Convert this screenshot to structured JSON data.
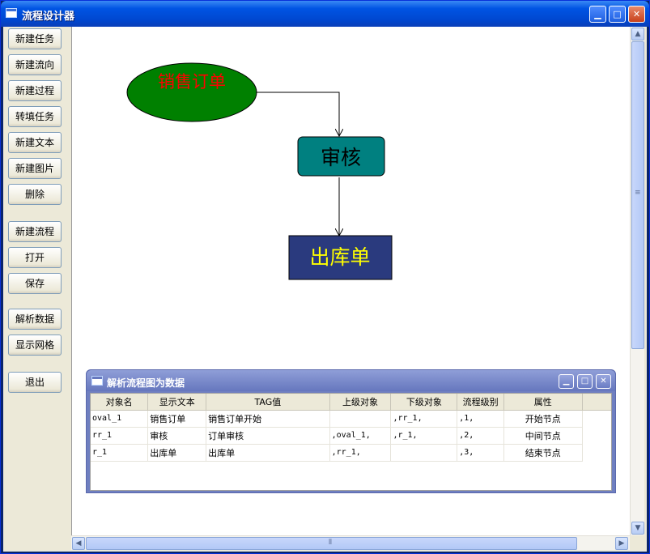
{
  "window": {
    "title": "流程设计器",
    "controls": {
      "minimize": "▁",
      "maximize": "□",
      "close": "✕"
    }
  },
  "toolbox": {
    "buttons": [
      "新建任务",
      "新建流向",
      "新建过程",
      "转填任务",
      "新建文本",
      "新建图片",
      "删除",
      "新建流程",
      "打开",
      "保存",
      "解析数据",
      "显示网格",
      "退出"
    ]
  },
  "diagram": {
    "nodes": [
      {
        "id": "oval_1",
        "label": "销售订单",
        "shape": "ellipse",
        "fill": "#008000",
        "text_color": "#ff0000"
      },
      {
        "id": "rr_1",
        "label": "审核",
        "shape": "rounded-rect",
        "fill": "#008080",
        "text_color": "#000000"
      },
      {
        "id": "r_1",
        "label": "出库单",
        "shape": "rect",
        "fill": "#2a3a7e",
        "text_color": "#ffff00"
      }
    ]
  },
  "data_window": {
    "title": "解析流程图为数据",
    "columns": [
      "对象名",
      "显示文本",
      "TAG值",
      "上级对象",
      "下级对象",
      "流程级别",
      "属性"
    ],
    "rows": [
      [
        "oval_1",
        "销售订单",
        "销售订单开始",
        "",
        ",rr_1,",
        ",1,",
        "开始节点"
      ],
      [
        "rr_1",
        "审核",
        "订单审核",
        ",oval_1,",
        ",r_1,",
        ",2,",
        "中间节点"
      ],
      [
        "r_1",
        "出库单",
        "出库单",
        ",rr_1,",
        "",
        ",3,",
        "结束节点"
      ]
    ]
  },
  "colors": {
    "titlebar": "#0054e3",
    "subtitlebar": "#6677be"
  },
  "icons": [
    "app-icon",
    "scroll-up-icon",
    "scroll-down-icon",
    "scroll-left-icon",
    "scroll-right-icon"
  ]
}
